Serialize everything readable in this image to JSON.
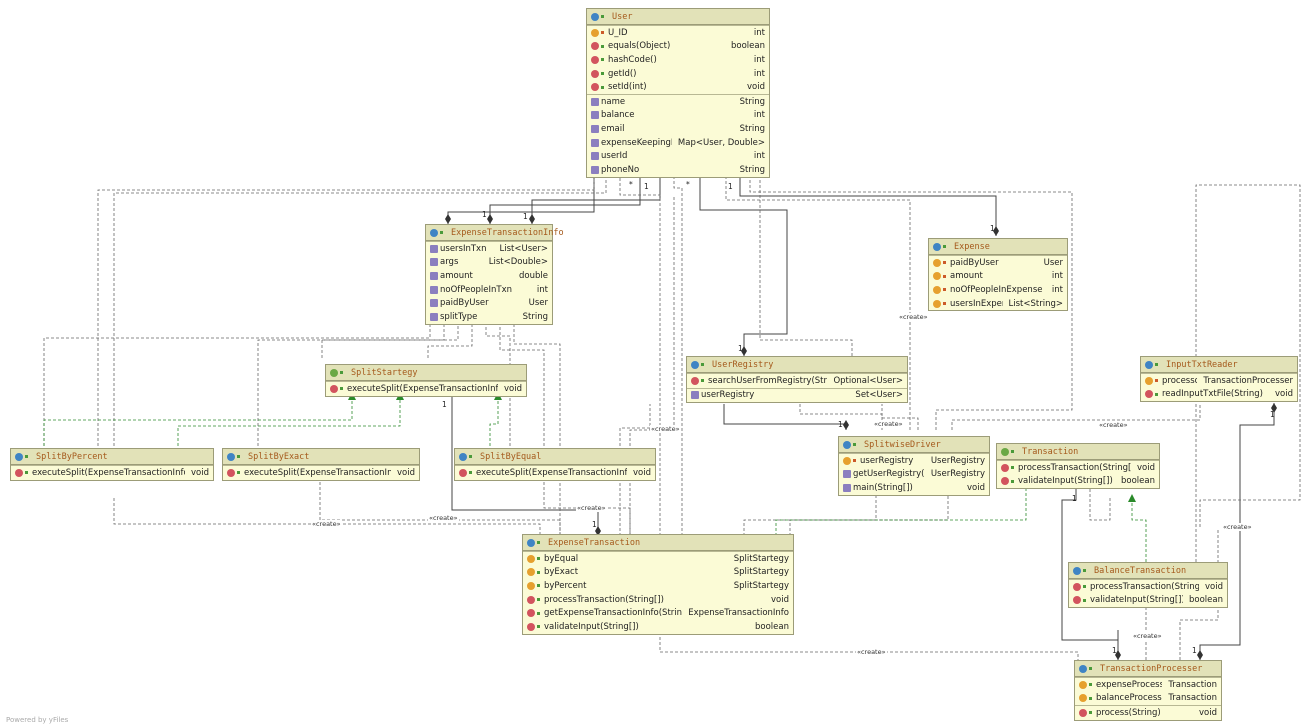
{
  "classes": [
    {
      "id": "user",
      "name": "User",
      "kind": "class",
      "sections": [
        [
          {
            "icon": "field",
            "vis": "priv",
            "name": "U_ID",
            "type": "int"
          },
          {
            "icon": "method",
            "vis": "pub",
            "name": "equals(Object)",
            "type": "boolean"
          },
          {
            "icon": "method",
            "vis": "pub",
            "name": "hashCode()",
            "type": "int"
          },
          {
            "icon": "method",
            "vis": "pub",
            "name": "getId()",
            "type": "int"
          },
          {
            "icon": "method",
            "vis": "pub",
            "name": "setId(int)",
            "type": "void"
          }
        ],
        [
          {
            "icon": "property",
            "vis": "none",
            "name": "name",
            "type": "String"
          },
          {
            "icon": "property",
            "vis": "none",
            "name": "balance",
            "type": "int"
          },
          {
            "icon": "property",
            "vis": "none",
            "name": "email",
            "type": "String"
          },
          {
            "icon": "property",
            "vis": "none",
            "name": "expenseKeepingBook",
            "type": "Map<User, Double>"
          },
          {
            "icon": "property",
            "vis": "none",
            "name": "userId",
            "type": "int"
          },
          {
            "icon": "property",
            "vis": "none",
            "name": "phoneNo",
            "type": "String"
          }
        ]
      ]
    },
    {
      "id": "eti",
      "name": "ExpenseTransactionInfo",
      "kind": "class",
      "sections": [
        [
          {
            "icon": "property",
            "vis": "none",
            "name": "usersInTxn",
            "type": "List<User>"
          },
          {
            "icon": "property",
            "vis": "none",
            "name": "args",
            "type": "List<Double>"
          },
          {
            "icon": "property",
            "vis": "none",
            "name": "amount",
            "type": "double"
          },
          {
            "icon": "property",
            "vis": "none",
            "name": "noOfPeopleInTxn",
            "type": "int"
          },
          {
            "icon": "property",
            "vis": "none",
            "name": "paidByUser",
            "type": "User"
          },
          {
            "icon": "property",
            "vis": "none",
            "name": "splitType",
            "type": "String"
          }
        ]
      ]
    },
    {
      "id": "expense",
      "name": "Expense",
      "kind": "class",
      "sections": [
        [
          {
            "icon": "field",
            "vis": "priv",
            "name": "paidByUser",
            "type": "User"
          },
          {
            "icon": "field",
            "vis": "priv",
            "name": "amount",
            "type": "int"
          },
          {
            "icon": "field",
            "vis": "priv",
            "name": "noOfPeopleInExpense",
            "type": "int"
          },
          {
            "icon": "field",
            "vis": "priv",
            "name": "usersInExpense",
            "type": "List<String>"
          }
        ]
      ]
    },
    {
      "id": "splitstrategy",
      "name": "SplitStartegy",
      "kind": "interface",
      "sections": [
        [
          {
            "icon": "method",
            "vis": "pub",
            "name": "executeSplit(ExpenseTransactionInfo)",
            "type": "void"
          }
        ]
      ]
    },
    {
      "id": "userregistry",
      "name": "UserRegistry",
      "kind": "class",
      "sections": [
        [
          {
            "icon": "method",
            "vis": "pub",
            "name": "searchUserFromRegistry(String)",
            "type": "Optional<User>"
          }
        ],
        [
          {
            "icon": "property",
            "vis": "none",
            "name": "userRegistry",
            "type": "Set<User>"
          }
        ]
      ]
    },
    {
      "id": "inputtxt",
      "name": "InputTxtReader",
      "kind": "class",
      "sections": [
        [
          {
            "icon": "field",
            "vis": "priv",
            "name": "processor",
            "type": "TransactionProcesser"
          },
          {
            "icon": "method",
            "vis": "pub",
            "name": "readInputTxtFile(String)",
            "type": "void"
          }
        ]
      ]
    },
    {
      "id": "splitpercent",
      "name": "SplitByPercent",
      "kind": "class",
      "sections": [
        [
          {
            "icon": "method",
            "vis": "pub",
            "name": "executeSplit(ExpenseTransactionInfo)",
            "type": "void"
          }
        ]
      ]
    },
    {
      "id": "splitexact",
      "name": "SplitByExact",
      "kind": "class",
      "sections": [
        [
          {
            "icon": "method",
            "vis": "pub",
            "name": "executeSplit(ExpenseTransactionInfo)",
            "type": "void"
          }
        ]
      ]
    },
    {
      "id": "splitequal",
      "name": "SplitByEqual",
      "kind": "class",
      "sections": [
        [
          {
            "icon": "method",
            "vis": "pub",
            "name": "executeSplit(ExpenseTransactionInfo)",
            "type": "void"
          }
        ]
      ]
    },
    {
      "id": "driver",
      "name": "SplitwiseDriver",
      "kind": "class",
      "sections": [
        [
          {
            "icon": "field",
            "vis": "priv",
            "name": "userRegistry",
            "type": "UserRegistry"
          },
          {
            "icon": "property",
            "vis": "none",
            "name": "getUserRegistry()",
            "type": "UserRegistry"
          },
          {
            "icon": "property",
            "vis": "none",
            "name": "main(String[])",
            "type": "void"
          }
        ]
      ]
    },
    {
      "id": "transaction",
      "name": "Transaction",
      "kind": "interface",
      "sections": [
        [
          {
            "icon": "method",
            "vis": "pub",
            "name": "processTransaction(String[])",
            "type": "void"
          },
          {
            "icon": "method",
            "vis": "pub",
            "name": "validateInput(String[])",
            "type": "boolean"
          }
        ]
      ]
    },
    {
      "id": "exptxn",
      "name": "ExpenseTransaction",
      "kind": "class",
      "sections": [
        [
          {
            "icon": "field",
            "vis": "pub",
            "name": "byEqual",
            "type": "SplitStartegy"
          },
          {
            "icon": "field",
            "vis": "pub",
            "name": "byExact",
            "type": "SplitStartegy"
          },
          {
            "icon": "field",
            "vis": "pub",
            "name": "byPercent",
            "type": "SplitStartegy"
          },
          {
            "icon": "method",
            "vis": "pub",
            "name": "processTransaction(String[])",
            "type": "void"
          },
          {
            "icon": "method",
            "vis": "pub",
            "name": "getExpenseTransactionInfo(String[])",
            "type": "ExpenseTransactionInfo"
          },
          {
            "icon": "method",
            "vis": "pub",
            "name": "validateInput(String[])",
            "type": "boolean"
          }
        ]
      ]
    },
    {
      "id": "baltxn",
      "name": "BalanceTransaction",
      "kind": "class",
      "sections": [
        [
          {
            "icon": "method",
            "vis": "pub",
            "name": "processTransaction(String[])",
            "type": "void"
          },
          {
            "icon": "method",
            "vis": "pub",
            "name": "validateInput(String[])",
            "type": "boolean"
          }
        ]
      ]
    },
    {
      "id": "txnproc",
      "name": "TransactionProcesser",
      "kind": "class",
      "sections": [
        [
          {
            "icon": "field",
            "vis": "pub",
            "name": "expenseProcessor",
            "type": "Transaction"
          },
          {
            "icon": "field",
            "vis": "pub",
            "name": "balanceProcessor",
            "type": "Transaction"
          }
        ],
        [
          {
            "icon": "method",
            "vis": "pub",
            "name": "process(String)",
            "type": "void"
          }
        ]
      ]
    }
  ],
  "create_label": "«create»",
  "multiplicities": [
    "1",
    "*",
    "1",
    "1",
    "1",
    "*",
    "1",
    "1",
    "1",
    "1",
    "1",
    "1",
    "1",
    "1",
    "1",
    "1",
    "1",
    "1",
    "1",
    "1"
  ],
  "footer": "Powered by yFiles"
}
